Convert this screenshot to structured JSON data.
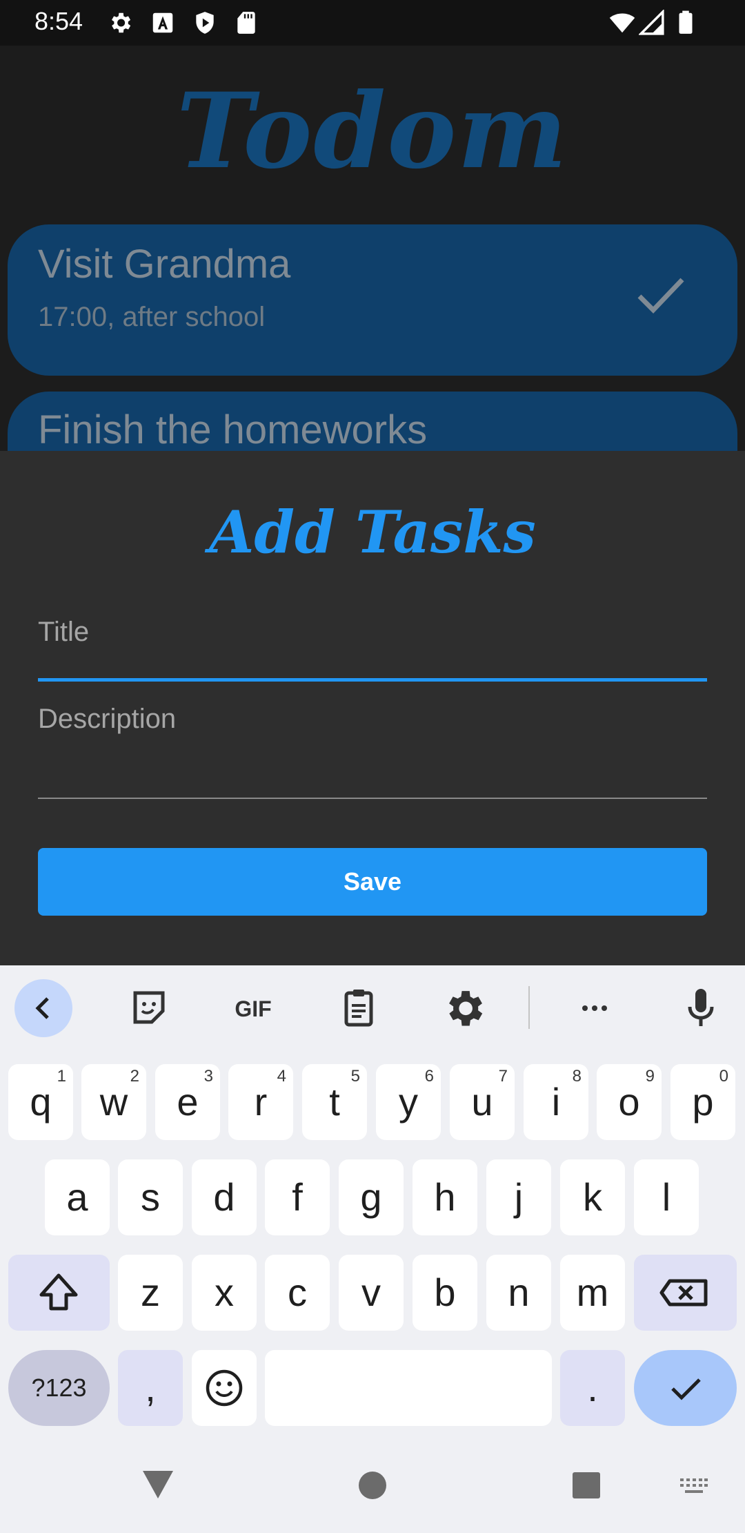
{
  "status_bar": {
    "time": "8:54"
  },
  "app": {
    "title": "Todom",
    "tasks": [
      {
        "title": "Visit Grandma",
        "description": "17:00, after school",
        "done": true
      },
      {
        "title": "Finish the homeworks"
      }
    ]
  },
  "sheet": {
    "title": "Add Tasks",
    "title_field": {
      "label": "Title",
      "value": ""
    },
    "description_field": {
      "label": "Description",
      "value": ""
    },
    "save_label": "Save"
  },
  "keyboard": {
    "row1": [
      {
        "k": "q",
        "h": "1"
      },
      {
        "k": "w",
        "h": "2"
      },
      {
        "k": "e",
        "h": "3"
      },
      {
        "k": "r",
        "h": "4"
      },
      {
        "k": "t",
        "h": "5"
      },
      {
        "k": "y",
        "h": "6"
      },
      {
        "k": "u",
        "h": "7"
      },
      {
        "k": "i",
        "h": "8"
      },
      {
        "k": "o",
        "h": "9"
      },
      {
        "k": "p",
        "h": "0"
      }
    ],
    "row2": [
      "a",
      "s",
      "d",
      "f",
      "g",
      "h",
      "j",
      "k",
      "l"
    ],
    "row3": [
      "z",
      "x",
      "c",
      "v",
      "b",
      "n",
      "m"
    ],
    "symbols_label": "?123",
    "comma": ",",
    "period": "."
  },
  "colors": {
    "accent": "#2196f3",
    "card": "#0f406b",
    "sheet": "#2e2e2e"
  }
}
